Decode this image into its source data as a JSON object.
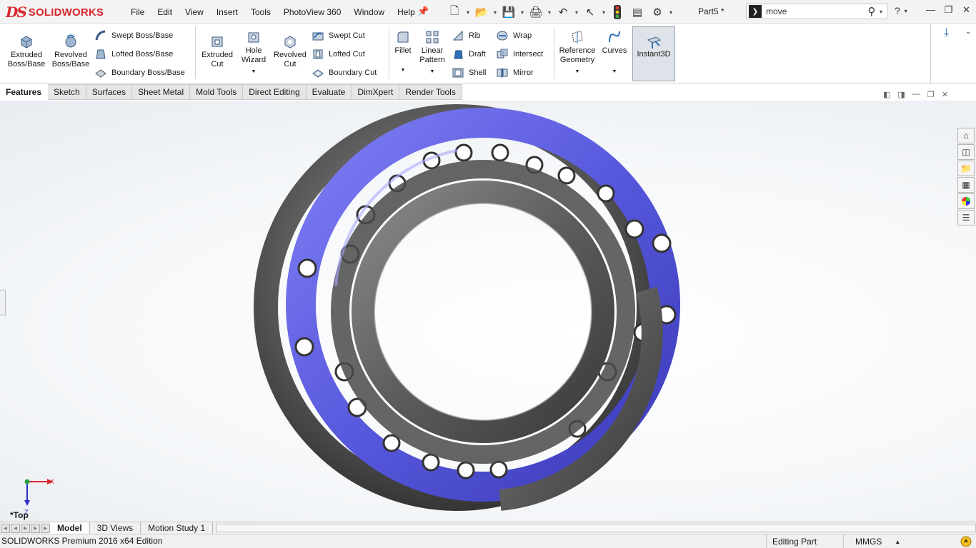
{
  "app": {
    "logo_mark": "DS",
    "logo_word": "SOLIDWORKS",
    "document_title": "Part5 *"
  },
  "menu": [
    "File",
    "Edit",
    "View",
    "Insert",
    "Tools",
    "PhotoView 360",
    "Window",
    "Help"
  ],
  "search": {
    "value": "move"
  },
  "ribbon": {
    "extruded_boss": "Extruded Boss/Base",
    "revolved_boss": "Revolved Boss/Base",
    "swept_boss": "Swept Boss/Base",
    "lofted_boss": "Lofted Boss/Base",
    "boundary_boss": "Boundary Boss/Base",
    "extruded_cut": "Extruded Cut",
    "hole_wizard": "Hole Wizard",
    "revolved_cut": "Revolved Cut",
    "swept_cut": "Swept Cut",
    "lofted_cut": "Lofted Cut",
    "boundary_cut": "Boundary Cut",
    "fillet": "Fillet",
    "linear_pattern": "Linear Pattern",
    "rib": "Rib",
    "draft": "Draft",
    "shell": "Shell",
    "wrap": "Wrap",
    "intersect": "Intersect",
    "mirror": "Mirror",
    "reference_geometry": "Reference Geometry",
    "curves": "Curves",
    "instant3d": "Instant3D"
  },
  "tabs": [
    {
      "label": "Features",
      "active": true
    },
    {
      "label": "Sketch",
      "active": false
    },
    {
      "label": "Surfaces",
      "active": false
    },
    {
      "label": "Sheet Metal",
      "active": false
    },
    {
      "label": "Mold Tools",
      "active": false
    },
    {
      "label": "Direct Editing",
      "active": false
    },
    {
      "label": "Evaluate",
      "active": false
    },
    {
      "label": "DimXpert",
      "active": false
    },
    {
      "label": "Render Tools",
      "active": false
    }
  ],
  "task_pane_icons": [
    "home-icon",
    "parts-icon",
    "folder-icon",
    "view-palette-icon",
    "appearances-icon",
    "custom-properties-icon"
  ],
  "view": {
    "orientation_label": "*Top",
    "axis_x": "X",
    "axis_z": "Z"
  },
  "bottom_tabs": [
    {
      "label": "Model",
      "active": true
    },
    {
      "label": "3D Views",
      "active": false
    },
    {
      "label": "Motion Study 1",
      "active": false
    }
  ],
  "status": {
    "edition": "SOLIDWORKS Premium 2016 x64 Edition",
    "mode": "Editing Part",
    "units": "MMGS"
  },
  "colors": {
    "brand_red": "#d9262e",
    "race_blue": "#5b5be0",
    "cage_gray": "#5a5a5a",
    "accent_blue": "#2c6fb6"
  }
}
